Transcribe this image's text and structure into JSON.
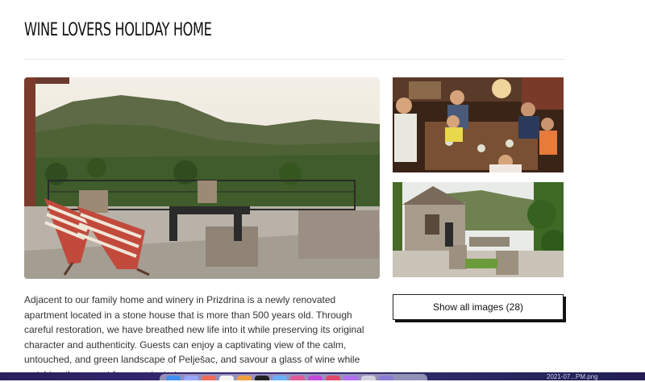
{
  "page": {
    "title": "WINE LOVERS HOLIDAY HOME",
    "description": "Adjacent to our family home and winery in Prizdrina is a newly renovated apartment located in a stone house that is more than 500 years old. Through careful restoration, we have breathed new life into it while preserving its original character and authenticity. Guests can enjoy a captivating view of the calm, untouched, and green landscape of Pelješac, and savour a glass of wine while watching the sunset from a private terrace."
  },
  "gallery": {
    "show_all_label": "Show all images (28)"
  },
  "taskbar": {
    "clock": "2021-07...PM.png",
    "dock_colors": [
      "#3f8ff0",
      "#9aa7ff",
      "#f06a5a",
      "#f4f4f4",
      "#f0a040",
      "#222222",
      "#6ab0ff",
      "#e05a9a",
      "#c24bd8",
      "#e04a6a",
      "#b070f0",
      "#d0d0e0",
      "#8a7ad8"
    ]
  },
  "colors": {
    "accent": "#111111",
    "taskbar": "#2a1f5c"
  }
}
